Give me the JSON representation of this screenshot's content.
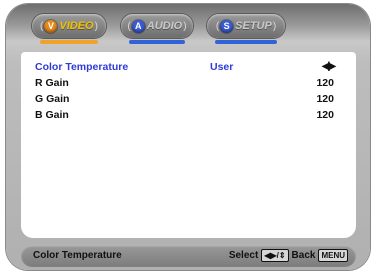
{
  "tabs": [
    {
      "label": "VIDEO",
      "ball_letter": "V",
      "ball_color": "#e8891b",
      "underline_color": "#f0a32a",
      "active": true
    },
    {
      "label": "AUDIO",
      "ball_letter": "A",
      "ball_color": "#3a5bd4",
      "underline_color": "#2f64d8",
      "active": false
    },
    {
      "label": "SETUP",
      "ball_letter": "S",
      "ball_color": "#3a5bd4",
      "underline_color": "#2f64d8",
      "active": false
    }
  ],
  "settings": {
    "color_temperature": {
      "label": "Color Temperature",
      "value": "User",
      "adjust_icon": "left-right-arrows-icon"
    },
    "r_gain": {
      "label": "R Gain",
      "value": "120"
    },
    "g_gain": {
      "label": "G Gain",
      "value": "120"
    },
    "b_gain": {
      "label": "B Gain",
      "value": "120"
    }
  },
  "footer": {
    "title": "Color Temperature",
    "select_label": "Select",
    "select_key": "◀▶/⇕",
    "back_label": "Back",
    "back_key": "MENU"
  },
  "colors": {
    "selected_text": "#2f3bd6",
    "active_tab_text": "#f1c100"
  }
}
